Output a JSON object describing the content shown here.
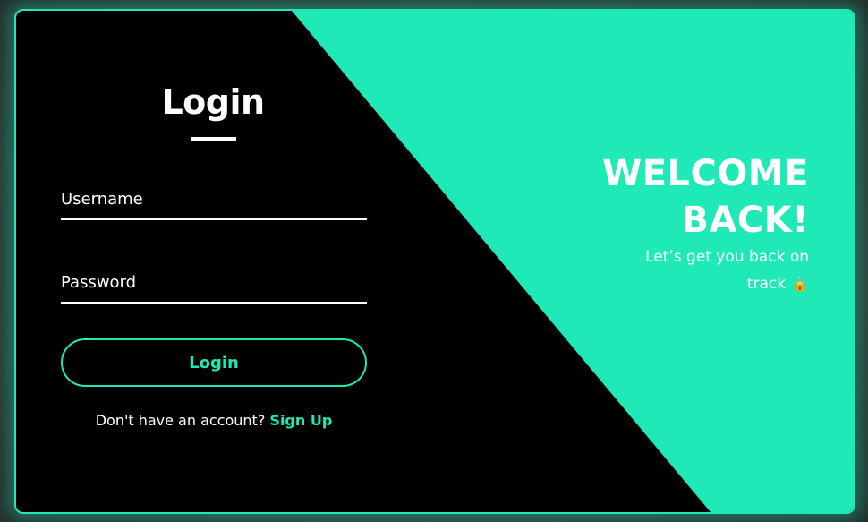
{
  "colors": {
    "accent": "#1fe9b6",
    "panel": "#000000",
    "text": "#ffffff"
  },
  "login": {
    "title": "Login",
    "username_placeholder": "Username",
    "password_placeholder": "Password",
    "button_label": "Login",
    "signup_prompt": "Don't have an account?",
    "signup_link": "Sign Up"
  },
  "welcome": {
    "title_line1": "WELCOME",
    "title_line2": "BACK!",
    "subtitle_line1": "Let’s get you back on",
    "subtitle_line2": "track",
    "icon": "lock-icon"
  }
}
